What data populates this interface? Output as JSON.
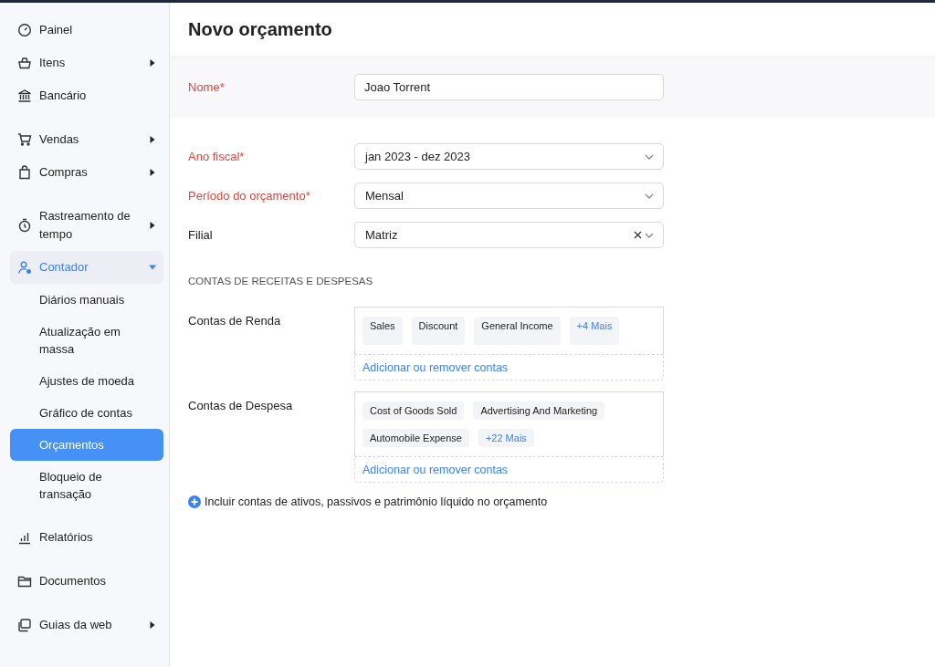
{
  "sidebar": {
    "groups": [
      [
        {
          "label": "Painel",
          "selected": false
        },
        {
          "label": "Itens",
          "selected": false,
          "expanded": false
        },
        {
          "label": "Bancário",
          "selected": false
        }
      ],
      [
        {
          "label": "Vendas",
          "selected": false,
          "expanded": false
        },
        {
          "label": "Compras",
          "selected": false,
          "expanded": false
        }
      ],
      [
        {
          "label": "Rastreamento de tempo",
          "selected": false,
          "expanded": false
        },
        {
          "label": "Contador",
          "selected": false,
          "expanded": true,
          "children": [
            {
              "label": "Diários manuais",
              "selected": false
            },
            {
              "label": "Atualização em massa",
              "selected": false
            },
            {
              "label": "Ajustes de moeda",
              "selected": false
            },
            {
              "label": "Gráfico de contas",
              "selected": false
            },
            {
              "label": "Orçamentos",
              "selected": true
            },
            {
              "label": "Bloqueio de transação",
              "selected": false
            }
          ]
        }
      ],
      [
        {
          "label": "Relatórios",
          "selected": false
        }
      ],
      [
        {
          "label": "Documentos",
          "selected": false
        }
      ],
      [
        {
          "label": "Guias da web",
          "selected": false,
          "expanded": false
        }
      ]
    ]
  },
  "page": {
    "title": "Novo orçamento"
  },
  "name_field": {
    "label": "Nome*",
    "required": true,
    "value": "Joao Torrent"
  },
  "fields": [
    {
      "label": "Ano fiscal*",
      "required": true,
      "kind": "select",
      "value": "jan 2023 - dez 2023"
    },
    {
      "label": "Período do orçamento*",
      "required": true,
      "kind": "select",
      "value": "Mensal"
    },
    {
      "label": "Filial",
      "required": false,
      "kind": "clearable",
      "value": "Matriz"
    }
  ],
  "accounts": {
    "heading": "CONTAS DE RECEITAS E DESPESAS",
    "groups": [
      {
        "label": "Contas de Renda",
        "tags": [
          {
            "text": "Sales",
            "kind": "tag"
          },
          {
            "text": "Discount",
            "kind": "tag"
          },
          {
            "text": "General Income",
            "kind": "tag"
          },
          {
            "text": "+4 Mais",
            "kind": "more"
          }
        ],
        "link": "Adicionar ou remover contas"
      },
      {
        "label": "Contas de Despesa",
        "tags": [
          {
            "text": "Cost of Goods Sold",
            "kind": "tag"
          },
          {
            "text": "Advertising And Marketing",
            "kind": "tag"
          },
          {
            "text": "Automobile Expense",
            "kind": "tag"
          },
          {
            "text": "+22 Mais",
            "kind": "more"
          }
        ],
        "link": "Adicionar ou remover contas"
      }
    ]
  },
  "include_link": "Incluir contas de ativos, passivos e patrimônio líquido no orçamento"
}
